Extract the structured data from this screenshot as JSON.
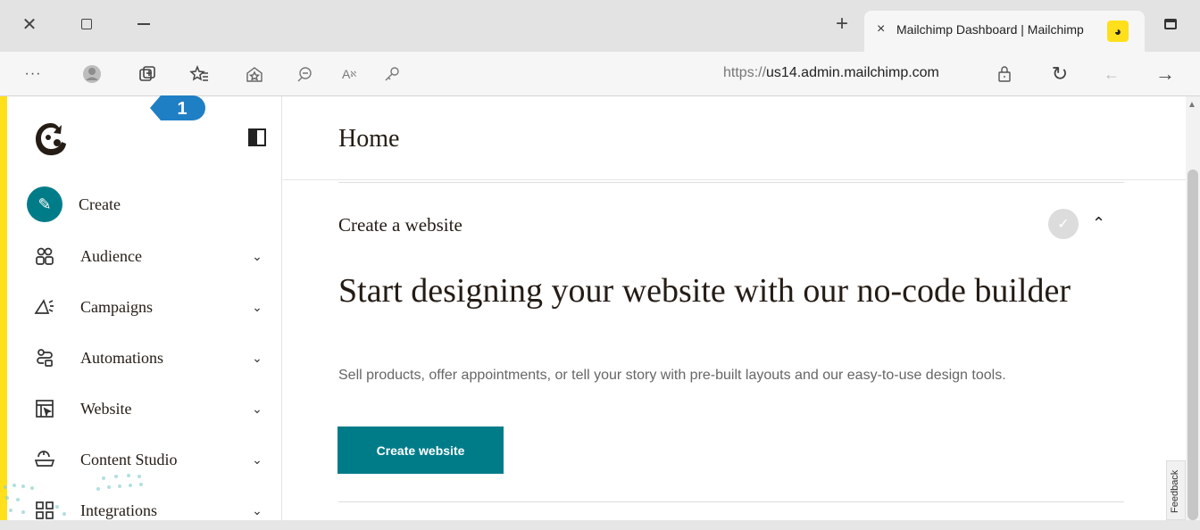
{
  "window": {
    "controls": [
      "close",
      "maximize",
      "minimize"
    ],
    "new_tab": "+",
    "tab_title": "Mailchimp Dashboard | Mailchimp",
    "tab_close": "×"
  },
  "toolbar": {
    "more": "···",
    "url_prefix": "https://",
    "url_host": "us14.admin.mailchimp.com"
  },
  "sidebar": {
    "items": [
      {
        "label": "Create",
        "icon": "pencil-icon"
      },
      {
        "label": "Audience",
        "icon": "audience-icon"
      },
      {
        "label": "Campaigns",
        "icon": "megaphone-icon"
      },
      {
        "label": "Automations",
        "icon": "automations-icon"
      },
      {
        "label": "Website",
        "icon": "website-icon"
      },
      {
        "label": "Content Studio",
        "icon": "content-studio-icon"
      },
      {
        "label": "Integrations",
        "icon": "integrations-icon"
      }
    ],
    "callout_number": "1"
  },
  "main": {
    "title": "Home",
    "card": {
      "label": "Create a website",
      "headline": "Start designing your website with our no-code builder",
      "description": "Sell products, offer appointments, or tell your story with pre-built layouts and our easy-to-use design tools.",
      "button": "Create website"
    },
    "feedback": "Feedback"
  },
  "colors": {
    "accent_yellow": "#ffe01b",
    "teal": "#007c89",
    "callout_blue": "#1f7fc4"
  }
}
